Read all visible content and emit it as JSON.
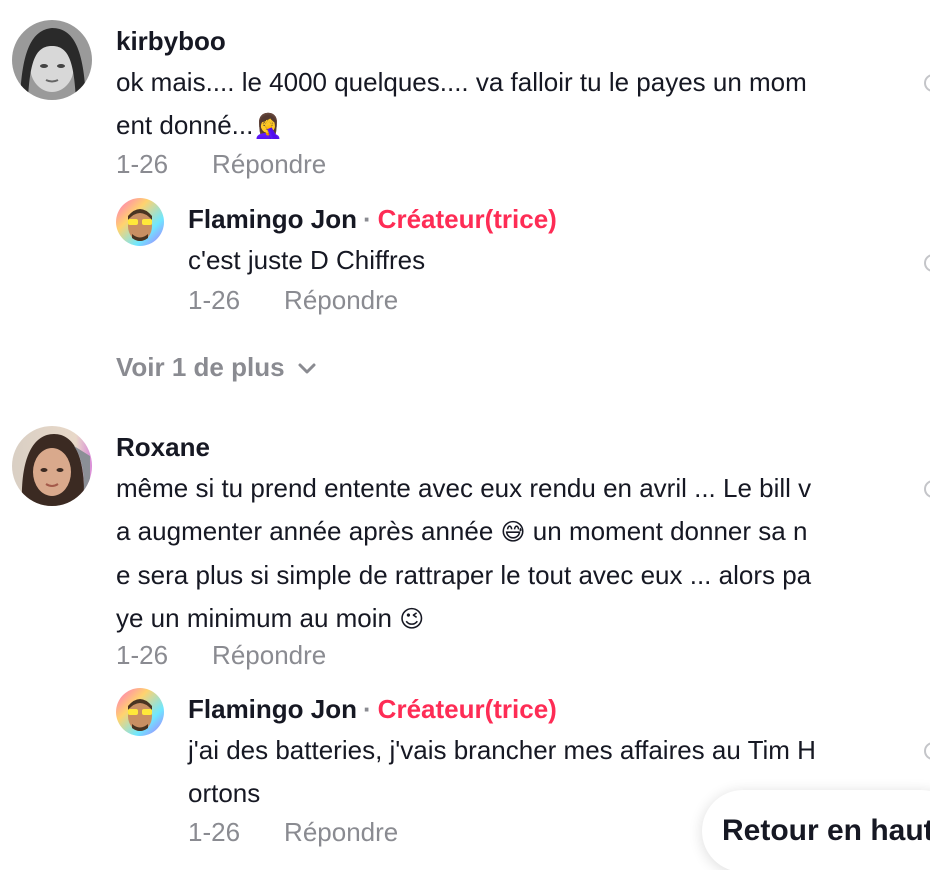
{
  "comments": [
    {
      "username": "kirbyboo",
      "lines": [
        "ok mais.... le 4000 quelques.... va falloir tu le payes un mom",
        "ent donné..."
      ],
      "emoji": "🤦‍♀️",
      "date": "1-26",
      "reply_label": "Répondre",
      "replies": [
        {
          "username": "Flamingo Jon",
          "separator": "·",
          "badge": "Créateur(trice)",
          "lines": [
            "c'est juste D Chiffres"
          ],
          "date": "1-26",
          "reply_label": "Répondre"
        }
      ],
      "view_more": "Voir 1 de plus"
    },
    {
      "username": "Roxane",
      "lines": [
        "même si tu prend entente avec eux rendu en avril ... Le bill v",
        "a augmenter année après année",
        "un moment donner sa n",
        "e sera plus si simple de rattraper le tout avec eux ... alors pa",
        "ye un minimum au moin"
      ],
      "emoji_1": "😅",
      "emoji_2": "😉",
      "date": "1-26",
      "reply_label": "Répondre",
      "replies": [
        {
          "username": "Flamingo Jon",
          "separator": "·",
          "badge": "Créateur(trice)",
          "lines": [
            "j'ai des batteries, j'vais brancher mes affaires au Tim H",
            "ortons"
          ],
          "date": "1-26",
          "reply_label": "Répondre"
        }
      ]
    }
  ],
  "back_to_top_label": "Retour en haut",
  "colors": {
    "creator_badge": "#fe2c55",
    "secondary_text": "#8a8b91",
    "primary_text": "#161823"
  },
  "icons": {
    "view_more": "chevron-down-icon",
    "like": "heart-icon"
  }
}
